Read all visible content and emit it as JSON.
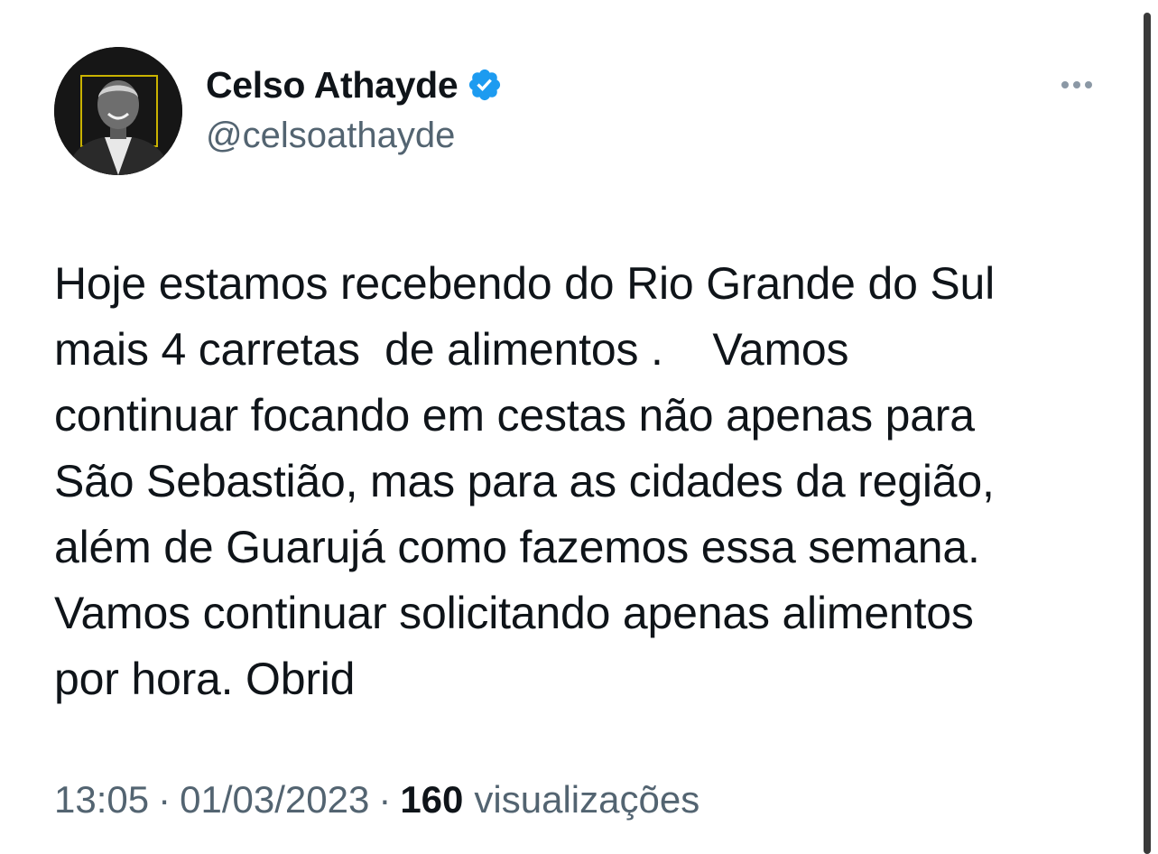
{
  "author": {
    "display_name": "Celso Athayde",
    "handle": "@celsoathayde",
    "verified": true,
    "verified_color": "#1d9bf0",
    "avatar_icon": "profile-photo"
  },
  "more_icon": "ellipsis-icon",
  "tweet": {
    "text": "Hoje estamos recebendo do Rio Grande do Sul\nmais 4 carretas  de alimentos .    Vamos\ncontinuar focando em cestas não apenas para\nSão Sebastião, mas para as cidades da região,\nalém de Guarujá como fazemos essa semana.\nVamos continuar solicitando apenas alimentos\npor hora. Obrid",
    "time": "13:05",
    "date": "01/03/2023",
    "separator": "·",
    "views_count": "160",
    "views_label": "visualizações"
  },
  "colors": {
    "text_primary": "#0f1419",
    "text_secondary": "#536471"
  }
}
